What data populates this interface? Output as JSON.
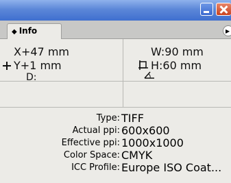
{
  "tab": {
    "label": "Info"
  },
  "position": {
    "x": "X+47 mm",
    "y": "Y+1 mm",
    "d": "D:"
  },
  "size": {
    "w": "W:90 mm",
    "h": "H:60 mm"
  },
  "details": [
    {
      "label": "Type:",
      "value": "TIFF"
    },
    {
      "label": "Actual ppi:",
      "value": "600x600"
    },
    {
      "label": "Effective ppi:",
      "value": "1000x1000"
    },
    {
      "label": "Color Space:",
      "value": "CMYK"
    },
    {
      "label": "ICC Profile:",
      "value": "Europe ISO Coat..."
    }
  ]
}
